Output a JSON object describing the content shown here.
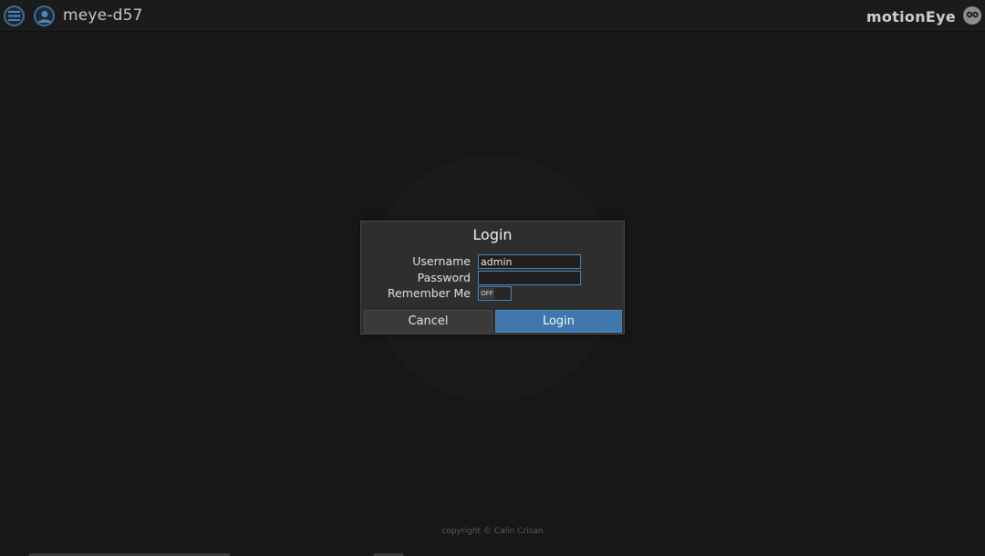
{
  "header": {
    "camera_name": "meye-d57",
    "brand": "motionEye"
  },
  "login_dialog": {
    "title": "Login",
    "username_label": "Username",
    "username_value": "admin",
    "password_label": "Password",
    "password_value": "",
    "remember_label": "Remember Me",
    "remember_toggle": "OFF",
    "cancel_label": "Cancel",
    "login_label": "Login"
  },
  "footer": {
    "copyright": "copyright © Calin Crisan"
  },
  "colors": {
    "accent": "#3e78ad",
    "background": "#171717"
  }
}
